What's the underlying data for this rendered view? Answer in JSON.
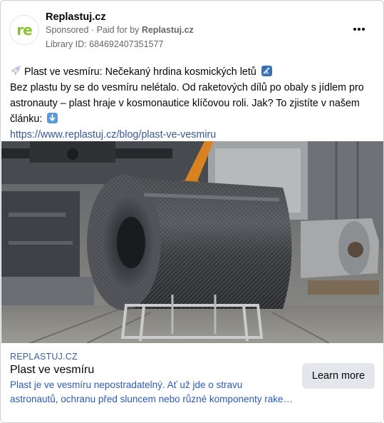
{
  "advertiser": {
    "name": "Replastuj.cz",
    "avatar_text": "re",
    "sponsored_label": "Sponsored",
    "paid_for_prefix": "· Paid for by",
    "paid_for_by": "Replastuj.cz",
    "library_id": "Library ID: 684692407351577"
  },
  "post": {
    "line1": "Plast ve vesmíru: Nečekaný hrdina kosmických letů",
    "line2": "Bez plastu by se do vesmíru nelétalo. Od raketových dílů po obaly s jídlem pro",
    "line3": "astronauty – plast hraje v kosmonautice klíčovou roli. Jak? To zjistíte v našem",
    "line4": "článku:",
    "link": "https://www.replastuj.cz/blog/plast-ve-vesmiru",
    "emojis": [
      "rocket-emoji",
      "telescope-emoji",
      "down-arrow-emoji"
    ]
  },
  "link_preview": {
    "domain": "REPLASTUJ.CZ",
    "title": "Plast ve vesmíru",
    "desc_line1": "Plast je ve vesmíru nepostradatelný. Ať už jde o stravu",
    "desc_line2": "astronautů, ochranu před sluncem nebo různé komponenty rake…",
    "cta": "Learn more"
  },
  "colors": {
    "brand_green": "#86c232",
    "link_blue": "#385898",
    "secondary_text": "#65676b",
    "button_bg": "#e4e6eb"
  }
}
